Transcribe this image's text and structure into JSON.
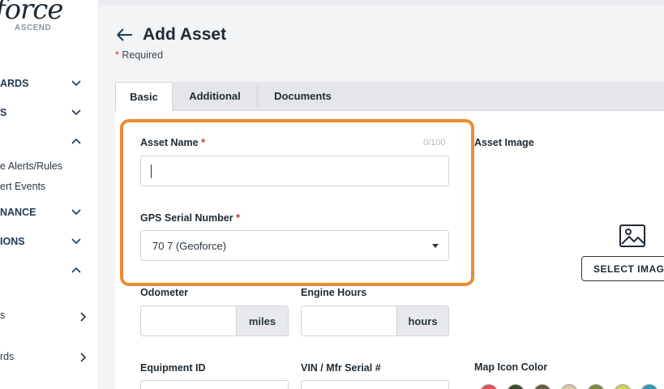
{
  "sidebar": {
    "logo_text": "force",
    "logo_sub": "ASCEND",
    "items": [
      {
        "label": "ARDS"
      },
      {
        "label": "S"
      },
      {
        "label": ""
      },
      {
        "label": "NANCE"
      },
      {
        "label": "IONS"
      },
      {
        "label": ""
      }
    ],
    "subitems": [
      {
        "label": "e Alerts/Rules"
      },
      {
        "label": "ert Events"
      },
      {
        "label": "s"
      },
      {
        "label": "rds"
      }
    ]
  },
  "page": {
    "title": "Add Asset",
    "required_star": "*",
    "required_label": "Required"
  },
  "tabs": [
    {
      "label": "Basic"
    },
    {
      "label": "Additional"
    },
    {
      "label": "Documents"
    }
  ],
  "form": {
    "asset_name": {
      "label": "Asset Name",
      "star": "*",
      "counter": "0/100",
      "value": ""
    },
    "gps_serial": {
      "label": "GPS Serial Number",
      "star": "*",
      "value": "70          7 (Geoforce)"
    },
    "odometer": {
      "label": "Odometer",
      "unit": "miles"
    },
    "engine_hours": {
      "label": "Engine Hours",
      "unit": "hours"
    },
    "equipment_id": {
      "label": "Equipment ID"
    },
    "vin": {
      "label": "VIN / Mfr Serial #"
    },
    "asset_image": {
      "label": "Asset Image",
      "button": "SELECT IMAGE"
    },
    "map_icon_color": {
      "label": "Map Icon Color"
    }
  },
  "swatch_colors": [
    "#d9534f",
    "#3d4a2a",
    "#6b5a3a",
    "#d8c7a0",
    "#7a8a3a",
    "#c9d64a",
    "#2a9bb0"
  ],
  "colors": {
    "highlight": "#ee8a2e",
    "required": "#c0392b"
  }
}
